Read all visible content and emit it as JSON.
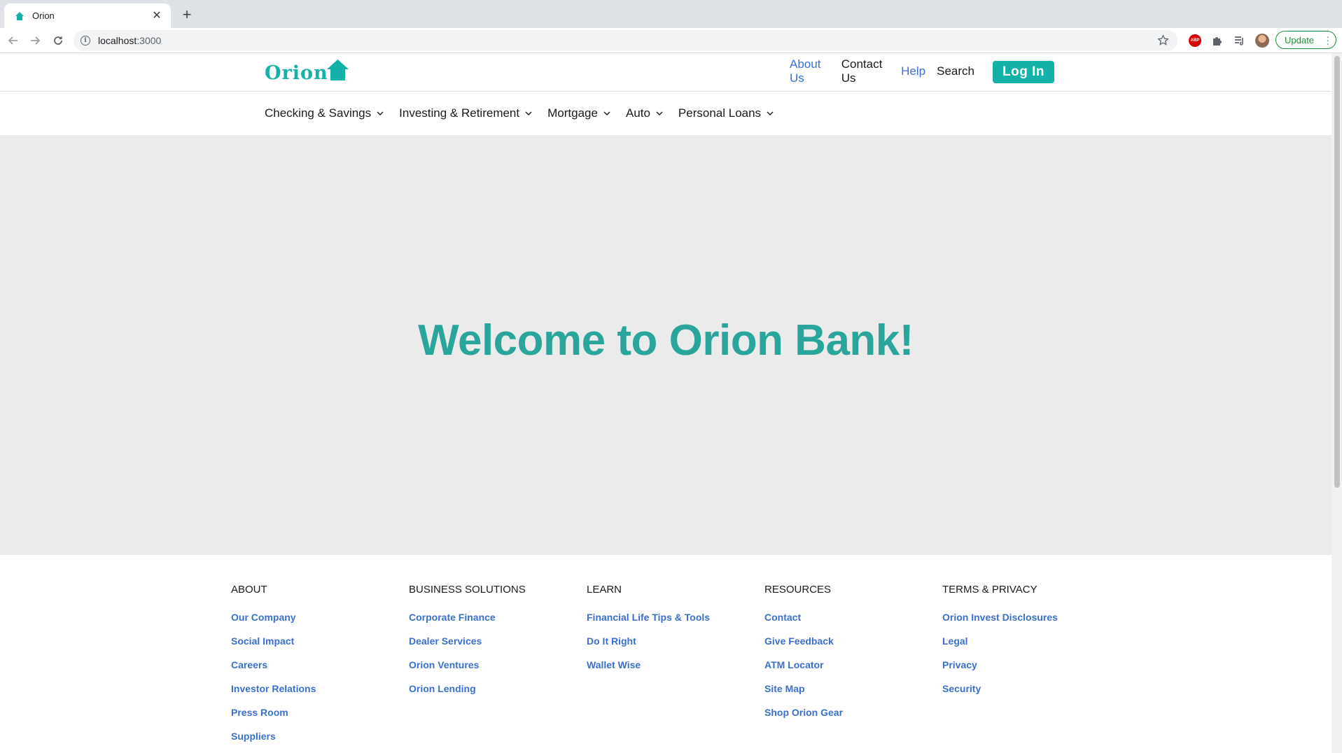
{
  "browser": {
    "tab_title": "Orion",
    "url_host": "localhost",
    "url_port": ":3000",
    "update_label": "Update"
  },
  "header": {
    "logo_text": "Orion",
    "nav": [
      {
        "label": "About Us"
      },
      {
        "label": "Contact Us"
      },
      {
        "label": "Help"
      },
      {
        "label": "Search"
      }
    ],
    "login_label": "Log In"
  },
  "menu": [
    {
      "label": "Checking & Savings"
    },
    {
      "label": "Investing & Retirement"
    },
    {
      "label": "Mortgage"
    },
    {
      "label": "Auto"
    },
    {
      "label": "Personal Loans"
    }
  ],
  "hero": {
    "title": "Welcome to Orion Bank!"
  },
  "footer": {
    "columns": [
      {
        "heading": "ABOUT",
        "links": [
          "Our Company",
          "Social Impact",
          "Careers",
          "Investor Relations",
          "Press Room",
          "Suppliers"
        ]
      },
      {
        "heading": "BUSINESS SOLUTIONS",
        "links": [
          "Corporate Finance",
          "Dealer Services",
          "Orion Ventures",
          "Orion Lending"
        ]
      },
      {
        "heading": "LEARN",
        "links": [
          "Financial Life Tips & Tools",
          "Do It Right",
          "Wallet Wise"
        ]
      },
      {
        "heading": "RESOURCES",
        "links": [
          "Contact",
          "Give Feedback",
          "ATM Locator",
          "Site Map",
          "Shop Orion Gear"
        ]
      },
      {
        "heading": "TERMS & PRIVACY",
        "links": [
          "Orion Invest Disclosures",
          "Legal",
          "Privacy",
          "Security"
        ]
      }
    ]
  },
  "colors": {
    "brand_teal": "#14b1a9",
    "hero_title": "#2aa59b",
    "link_blue": "#3b6fce",
    "hero_bg": "#ebebeb"
  }
}
